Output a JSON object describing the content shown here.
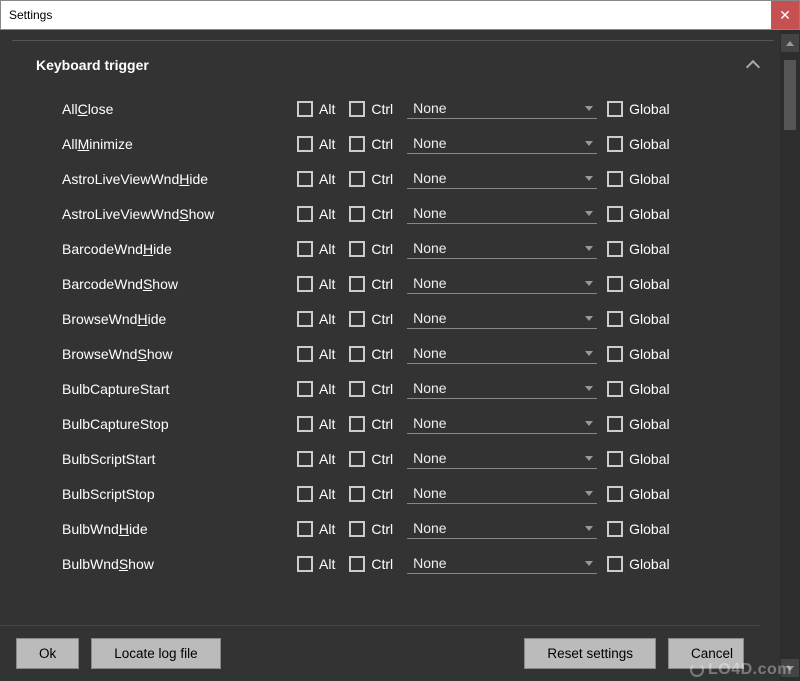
{
  "window": {
    "title": "Settings"
  },
  "section": {
    "title": "Keyboard trigger"
  },
  "labels": {
    "alt": "Alt",
    "ctrl": "Ctrl",
    "global": "Global",
    "dropdown_none": "None"
  },
  "triggers": [
    {
      "pre": "All",
      "u": "C",
      "post": "lose"
    },
    {
      "pre": "All",
      "u": "M",
      "post": "inimize"
    },
    {
      "pre": "AstroLiveViewWnd",
      "u": "H",
      "post": "ide"
    },
    {
      "pre": "AstroLiveViewWnd",
      "u": "S",
      "post": "how"
    },
    {
      "pre": "BarcodeWnd",
      "u": "H",
      "post": "ide"
    },
    {
      "pre": "BarcodeWnd",
      "u": "S",
      "post": "how"
    },
    {
      "pre": "BrowseWnd",
      "u": "H",
      "post": "ide"
    },
    {
      "pre": "BrowseWnd",
      "u": "S",
      "post": "how"
    },
    {
      "pre": "BulbCaptureStart",
      "u": "",
      "post": ""
    },
    {
      "pre": "BulbCaptureStop",
      "u": "",
      "post": ""
    },
    {
      "pre": "BulbScriptStart",
      "u": "",
      "post": ""
    },
    {
      "pre": "BulbScriptStop",
      "u": "",
      "post": ""
    },
    {
      "pre": "BulbWnd",
      "u": "H",
      "post": "ide"
    },
    {
      "pre": "BulbWnd",
      "u": "S",
      "post": "how"
    }
  ],
  "buttons": {
    "ok": "Ok",
    "locate_log": "Locate log file",
    "reset": "Reset settings",
    "cancel": "Cancel"
  },
  "watermark": "LO4D.com"
}
